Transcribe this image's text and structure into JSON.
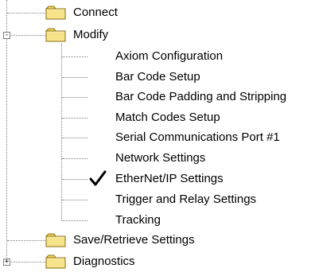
{
  "tree": {
    "items": [
      {
        "label": "Connect",
        "icon": "folder-icon",
        "expander": "none"
      },
      {
        "label": "Modify",
        "icon": "folder-icon",
        "expander": "-",
        "children": [
          {
            "label": "Axiom Configuration"
          },
          {
            "label": "Bar Code Setup"
          },
          {
            "label": "Bar Code Padding and Stripping"
          },
          {
            "label": "Match Codes Setup"
          },
          {
            "label": "Serial Communications Port #1"
          },
          {
            "label": "Network Settings"
          },
          {
            "label": "EtherNet/IP Settings",
            "checked": true,
            "check_icon": "checkmark-icon"
          },
          {
            "label": "Trigger and Relay Settings"
          },
          {
            "label": "Tracking"
          }
        ]
      },
      {
        "label": "Save/Retrieve Settings",
        "icon": "folder-icon",
        "expander": "none"
      },
      {
        "label": "Diagnostics",
        "icon": "folder-icon",
        "expander": "+"
      }
    ],
    "colors": {
      "folder_fill": "#f7e38a",
      "folder_tab": "#f3d75f",
      "folder_outline": "#8a6f12",
      "line": "#808080"
    }
  }
}
